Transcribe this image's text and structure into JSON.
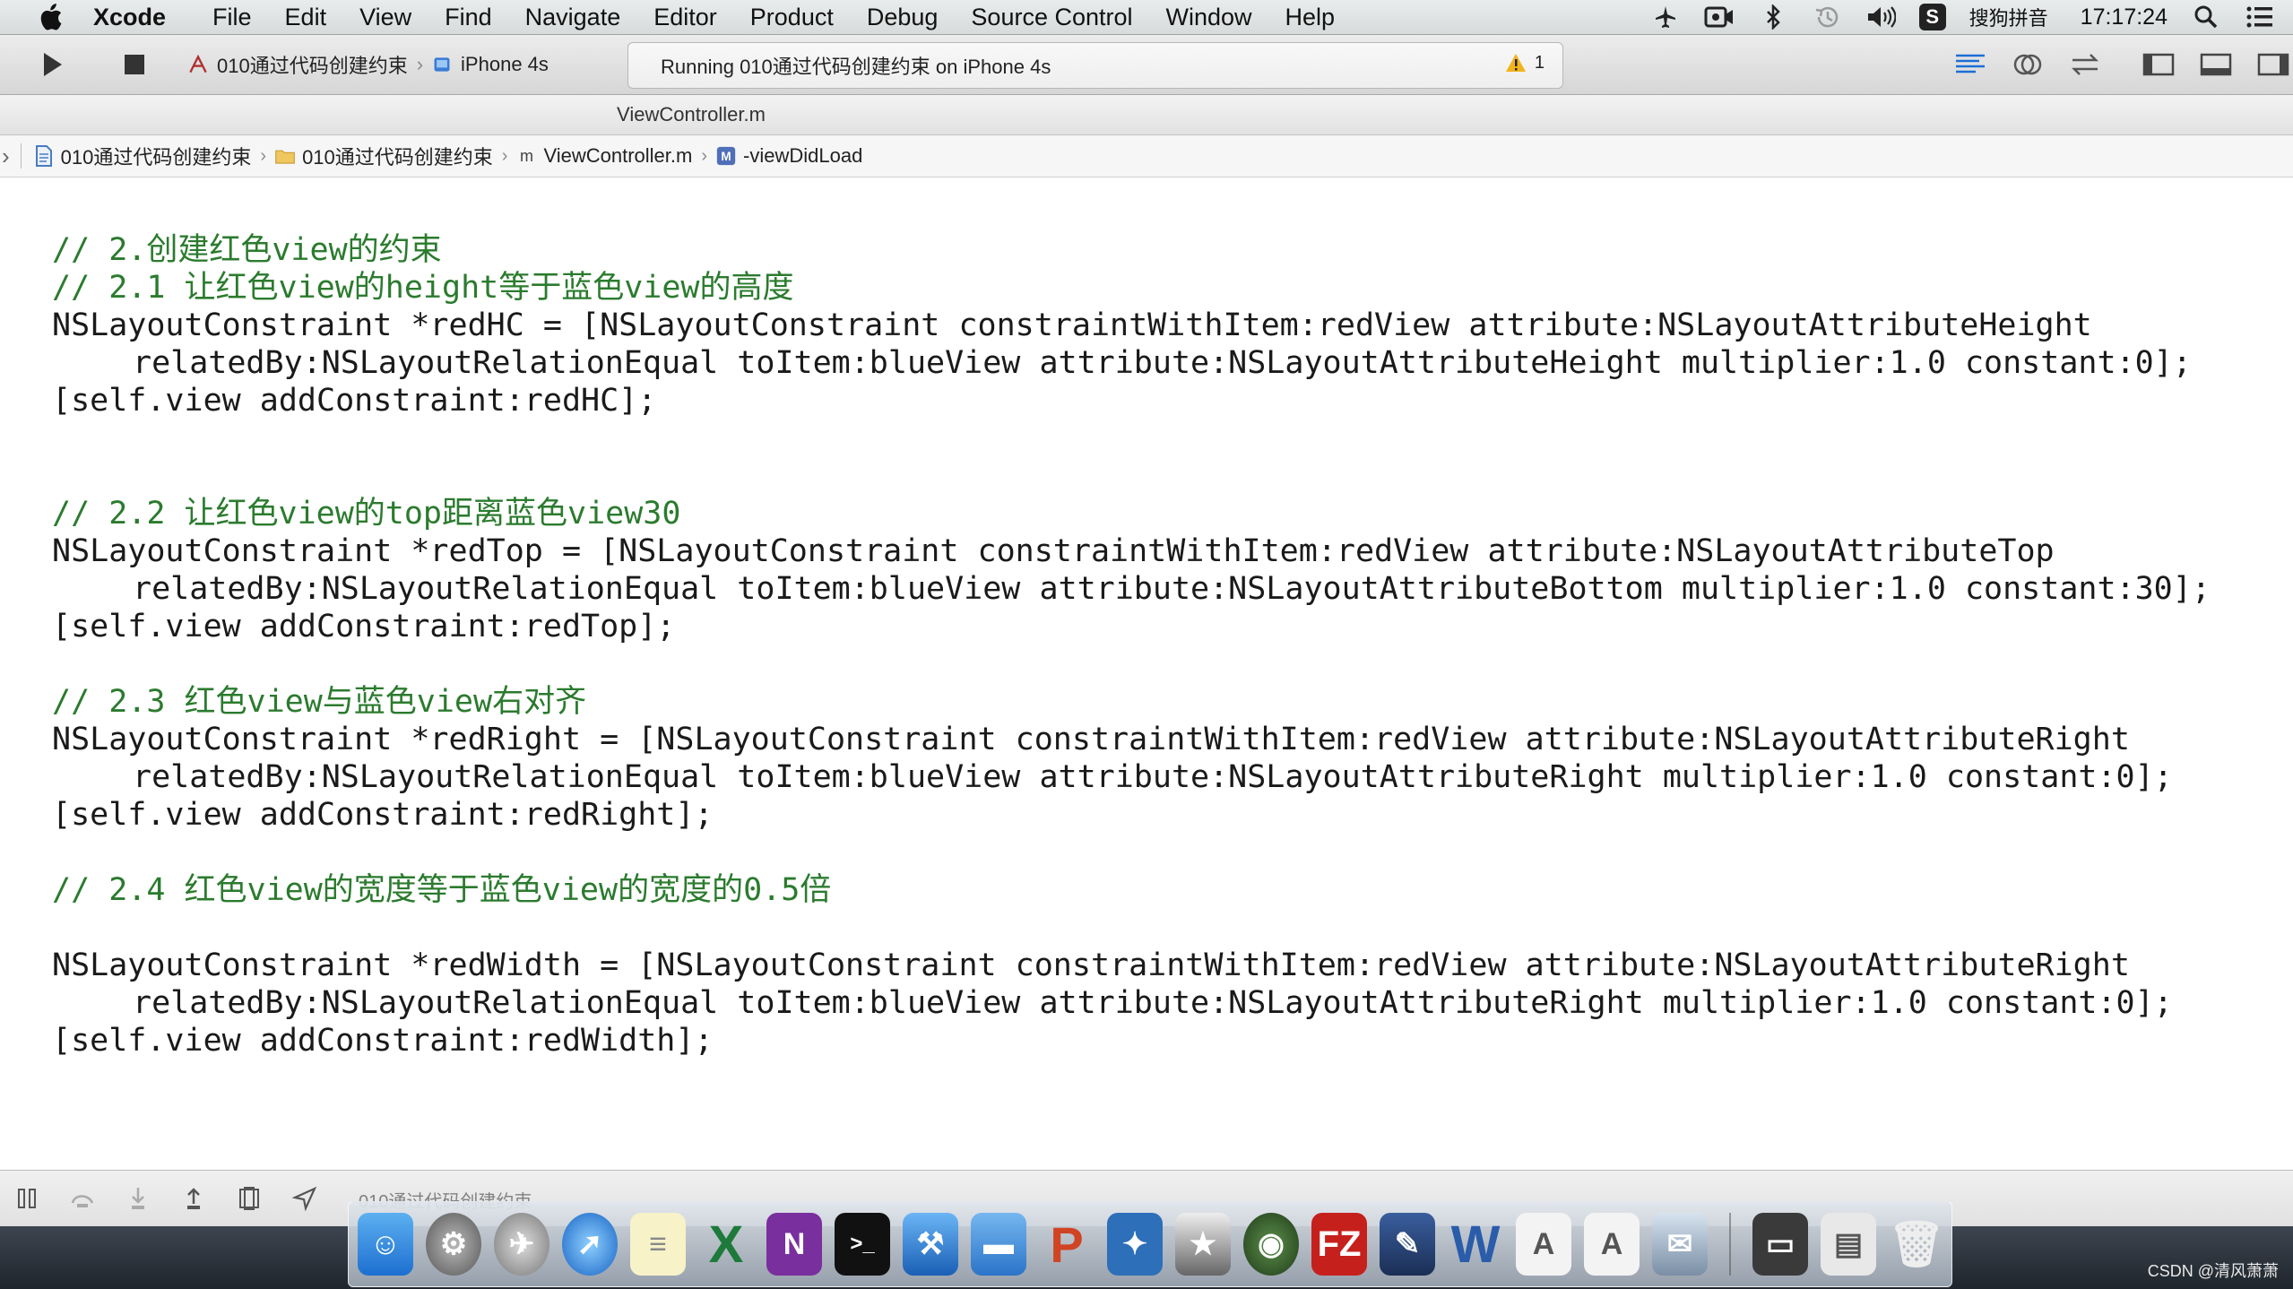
{
  "menubar": {
    "app": "Xcode",
    "items": [
      "File",
      "Edit",
      "View",
      "Find",
      "Navigate",
      "Editor",
      "Product",
      "Debug",
      "Source Control",
      "Window",
      "Help"
    ],
    "ime_label": "搜狗拼音",
    "clock": "17:17:24"
  },
  "toolbar": {
    "scheme_project": "010通过代码创建约束",
    "scheme_device": "iPhone 4s",
    "activity_text": "Running 010通过代码创建约束 on iPhone 4s",
    "warning_count": "1"
  },
  "editor": {
    "title": "ViewController.m"
  },
  "jumpbar": {
    "crumbs": [
      "010通过代码创建约束",
      "010通过代码创建约束",
      "ViewController.m",
      "-viewDidLoad"
    ]
  },
  "code": {
    "lines": [
      "// 2.创建红色view的约束",
      "// 2.1 让红色view的height等于蓝色view的高度",
      "NSLayoutConstraint *redHC = [NSLayoutConstraint constraintWithItem:redView attribute:NSLayoutAttributeHeight",
      "relatedBy:NSLayoutRelationEqual toItem:blueView attribute:NSLayoutAttributeHeight multiplier:1.0 constant:0];",
      "[self.view addConstraint:redHC];",
      "// 2.2 让红色view的top距离蓝色view30",
      "NSLayoutConstraint *redTop = [NSLayoutConstraint constraintWithItem:redView attribute:NSLayoutAttributeTop",
      "relatedBy:NSLayoutRelationEqual toItem:blueView attribute:NSLayoutAttributeBottom multiplier:1.0 constant:30];",
      "[self.view addConstraint:redTop];",
      "// 2.3 红色view与蓝色view右对齐",
      "NSLayoutConstraint *redRight = [NSLayoutConstraint constraintWithItem:redView attribute:NSLayoutAttributeRight",
      "relatedBy:NSLayoutRelationEqual toItem:blueView attribute:NSLayoutAttributeRight multiplier:1.0 constant:0];",
      "[self.view addConstraint:redRight];",
      "// 2.4 红色view的宽度等于蓝色view的宽度的0.5倍",
      "NSLayoutConstraint *redWidth = [NSLayoutConstraint constraintWithItem:redView attribute:NSLayoutAttributeRight",
      "relatedBy:NSLayoutRelationEqual toItem:blueView attribute:NSLayoutAttributeRight multiplier:1.0 constant:0];",
      "[self.view addConstraint:redWidth];"
    ]
  },
  "debugbar": {
    "target": "010通过代码创建约束"
  },
  "dock": {
    "apps": [
      "finder-icon",
      "system-preferences-icon",
      "launchpad-icon",
      "safari-icon",
      "notes-icon",
      "excel-icon",
      "onenote-icon",
      "terminal-icon",
      "xcode-icon",
      "folder-icon",
      "powerpoint-icon",
      "instruments-icon",
      "imovie-icon",
      "reeder-icon",
      "filezilla-icon",
      "photoshop-icon",
      "word-icon",
      "preview-icon",
      "textedit-icon",
      "mail-icon",
      "screen-sharing-icon",
      "image-capture-icon",
      "trash-icon"
    ]
  },
  "watermark": "CSDN @清风萧萧"
}
